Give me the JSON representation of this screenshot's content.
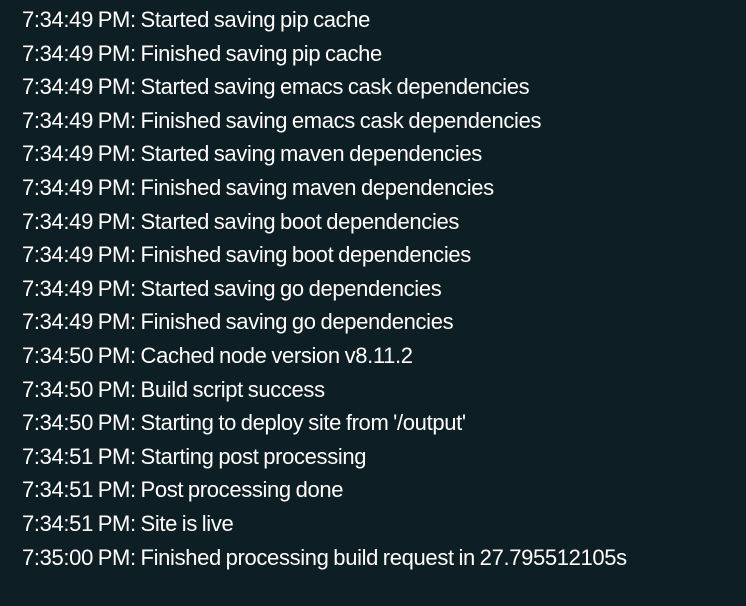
{
  "log": {
    "lines": [
      "7:34:49 PM: Started saving pip cache",
      "7:34:49 PM: Finished saving pip cache",
      "7:34:49 PM: Started saving emacs cask dependencies",
      "7:34:49 PM: Finished saving emacs cask dependencies",
      "7:34:49 PM: Started saving maven dependencies",
      "7:34:49 PM: Finished saving maven dependencies",
      "7:34:49 PM: Started saving boot dependencies",
      "7:34:49 PM: Finished saving boot dependencies",
      "7:34:49 PM: Started saving go dependencies",
      "7:34:49 PM: Finished saving go dependencies",
      "7:34:50 PM: Cached node version v8.11.2",
      "7:34:50 PM: Build script success",
      "7:34:50 PM: Starting to deploy site from '/output'",
      "7:34:51 PM: Starting post processing",
      "7:34:51 PM: Post processing done",
      "7:34:51 PM: Site is live",
      "7:35:00 PM: Finished processing build request in 27.795512105s"
    ]
  },
  "colors": {
    "background": "#0e1e25",
    "text": "#ffffff"
  }
}
